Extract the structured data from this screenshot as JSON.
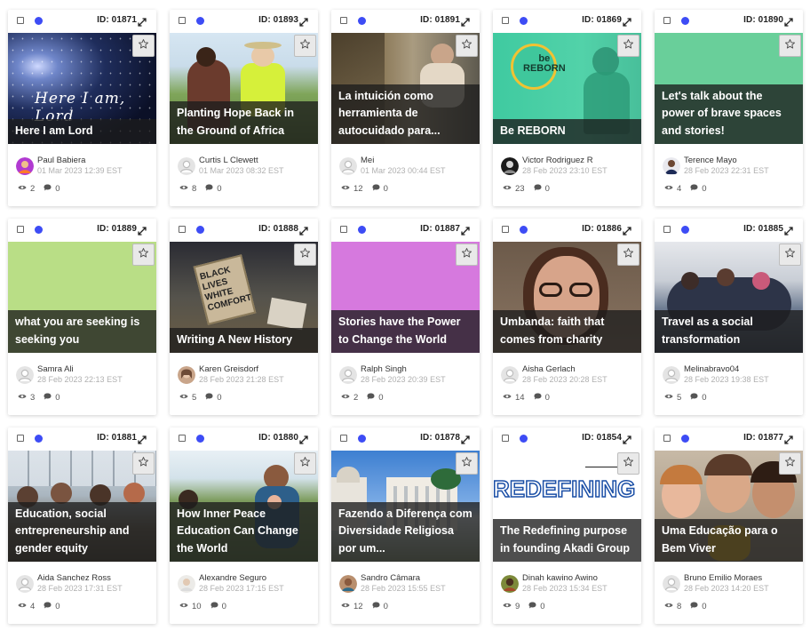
{
  "cards": [
    {
      "id": "ID: 01871",
      "title": "Here I am Lord",
      "author": "Paul Babiera",
      "date": "01 Mar 2023 12:39 EST",
      "views": "2",
      "comments": "0",
      "media": "galaxy",
      "avatar": "purple"
    },
    {
      "id": "ID: 01893",
      "title": "Planting Hope Back in the Ground of Africa",
      "author": "Curtis L Clewett",
      "date": "01 Mar 2023 08:32 EST",
      "views": "8",
      "comments": "0",
      "media": "farm",
      "avatar": "default"
    },
    {
      "id": "ID: 01891",
      "title": "La intuición como herramienta de autocuidado para...",
      "author": "Mei",
      "date": "01 Mar 2023 00:44 EST",
      "views": "12",
      "comments": "0",
      "media": "hallway",
      "avatar": "default"
    },
    {
      "id": "ID: 01869",
      "title": "Be REBORN",
      "author": "Victor Rodriguez R",
      "date": "28 Feb 2023 23:10 EST",
      "views": "23",
      "comments": "0",
      "media": "reborn",
      "avatar": "dark"
    },
    {
      "id": "ID: 01890",
      "title": "Let's talk about the power of brave spaces and stories!",
      "author": "Terence Mayo",
      "date": "28 Feb 2023 22:31 EST",
      "views": "4",
      "comments": "0",
      "media": "green",
      "avatar": "person"
    },
    {
      "id": "ID: 01889",
      "title": "what you are seeking is seeking you",
      "author": "Samra Ali",
      "date": "28 Feb 2023 22:13 EST",
      "views": "3",
      "comments": "0",
      "media": "lightgreen",
      "avatar": "default"
    },
    {
      "id": "ID: 01888",
      "title": "Writing A New History",
      "author": "Karen Greisdorf",
      "date": "28 Feb 2023 21:28 EST",
      "views": "5",
      "comments": "0",
      "media": "protest",
      "avatar": "woman"
    },
    {
      "id": "ID: 01887",
      "title": "Stories have the Power to Change the World",
      "author": "Ralph Singh",
      "date": "28 Feb 2023 20:39 EST",
      "views": "2",
      "comments": "0",
      "media": "violet",
      "avatar": "default"
    },
    {
      "id": "ID: 01886",
      "title": "Umbanda: faith that comes from charity",
      "author": "Aisha Gerlach",
      "date": "28 Feb 2023 20:28 EST",
      "views": "14",
      "comments": "0",
      "media": "selfie",
      "avatar": "default"
    },
    {
      "id": "ID: 01885",
      "title": "Travel as a social transformation",
      "author": "Melinabravo04",
      "date": "28 Feb 2023 19:38 EST",
      "views": "5",
      "comments": "0",
      "media": "group",
      "avatar": "default"
    },
    {
      "id": "ID: 01881",
      "title": "Education, social entrepreneurship and gender equity",
      "author": "Aida Sanchez Ross",
      "date": "28 Feb 2023 17:31 EST",
      "views": "4",
      "comments": "0",
      "media": "classroom",
      "avatar": "default"
    },
    {
      "id": "ID: 01880",
      "title": "How Inner Peace Education Can Change the World",
      "author": "Alexandre Seguro",
      "date": "28 Feb 2023 17:15 EST",
      "views": "10",
      "comments": "0",
      "media": "outdoor",
      "avatar": "light"
    },
    {
      "id": "ID: 01878",
      "title": "Fazendo a Diferença com Diversidade Religiosa por um...",
      "author": "Sandro Câmara",
      "date": "28 Feb 2023 15:55 EST",
      "views": "12",
      "comments": "0",
      "media": "building",
      "avatar": "man"
    },
    {
      "id": "ID: 01854",
      "title": "The Redefining purpose in founding Akadi Group",
      "author": "Dinah kawino Awino",
      "date": "28 Feb 2023 15:34 EST",
      "views": "9",
      "comments": "0",
      "media": "redefining",
      "avatar": "olive",
      "media_text": "REDEFINING"
    },
    {
      "id": "ID: 01877",
      "title": "Uma Educação para o Bem Viver",
      "author": "Bruno Emilio Moraes",
      "date": "28 Feb 2023 14:20 EST",
      "views": "8",
      "comments": "0",
      "media": "kids",
      "avatar": "default"
    }
  ]
}
